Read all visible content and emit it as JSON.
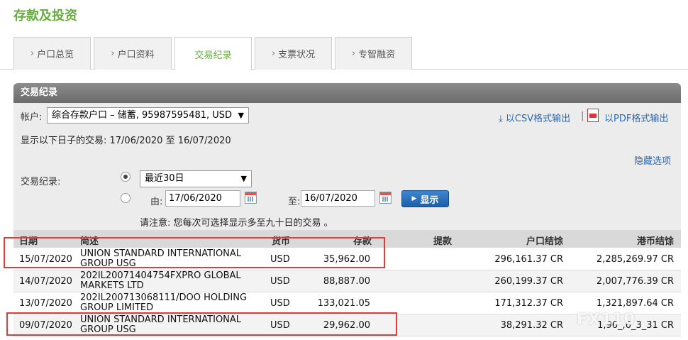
{
  "page": {
    "title": "存款及投资"
  },
  "tabs": [
    {
      "label": "户口总览"
    },
    {
      "label": "户口资料"
    },
    {
      "label": "交易纪录"
    },
    {
      "label": "支票状况"
    },
    {
      "label": "专智融资"
    }
  ],
  "section": {
    "title": "交易纪录"
  },
  "account": {
    "label": "帐户:",
    "selected": "综合存款户口 – 储蓄, 95987595481, USD"
  },
  "export": {
    "csv": "以CSV格式输出",
    "separator": "|",
    "pdf": "以PDF格式输出"
  },
  "date_range_text": "显示以下日子的交易: 17/06/2020 至 16/07/2020",
  "hide_options": "隐藏选项",
  "filter": {
    "records_label": "交易纪录:",
    "period_selected": "最近30日",
    "from_label": "由:",
    "from_value": "17/06/2020",
    "to_label": "至:",
    "to_value": "16/07/2020",
    "show_button": "显示",
    "note": "请注意: 您每次可选择显示多至九十日的交易 。"
  },
  "table": {
    "headers": [
      "日期",
      "简述",
      "货币",
      "存款",
      "提款",
      "户口结馀",
      "港币结馀"
    ],
    "rows": [
      {
        "date": "15/07/2020",
        "desc": "UNION STANDARD INTERNATIONAL GROUP USG",
        "currency": "USD",
        "deposit": "35,962.00",
        "withdrawal": "",
        "balance": "296,161.37 CR",
        "hkd_balance": "2,285,269.97 CR"
      },
      {
        "date": "14/07/2020",
        "desc": "202IL20071404754FXPRO GLOBAL MARKETS LTD",
        "currency": "USD",
        "deposit": "88,887.00",
        "withdrawal": "",
        "balance": "260,199.37 CR",
        "hkd_balance": "2,007,776.39 CR"
      },
      {
        "date": "13/07/2020",
        "desc": "202IL200713068111/DOO HOLDING GROUP LIMITED",
        "currency": "USD",
        "deposit": "133,021.05",
        "withdrawal": "",
        "balance": "171,312.37 CR",
        "hkd_balance": "1,321,897.64 CR"
      },
      {
        "date": "09/07/2020",
        "desc": "UNION STANDARD INTERNATIONAL GROUP USG",
        "currency": "USD",
        "deposit": "29,962.00",
        "withdrawal": "",
        "balance": "38,291.32 CR",
        "hkd_balance": "1,96_,6_3_31 CR"
      }
    ]
  },
  "colors": {
    "brand_green": "#67ad3f",
    "link_blue": "#2a6bb4",
    "highlight_red": "#e23b3b"
  },
  "watermark": "FX110"
}
